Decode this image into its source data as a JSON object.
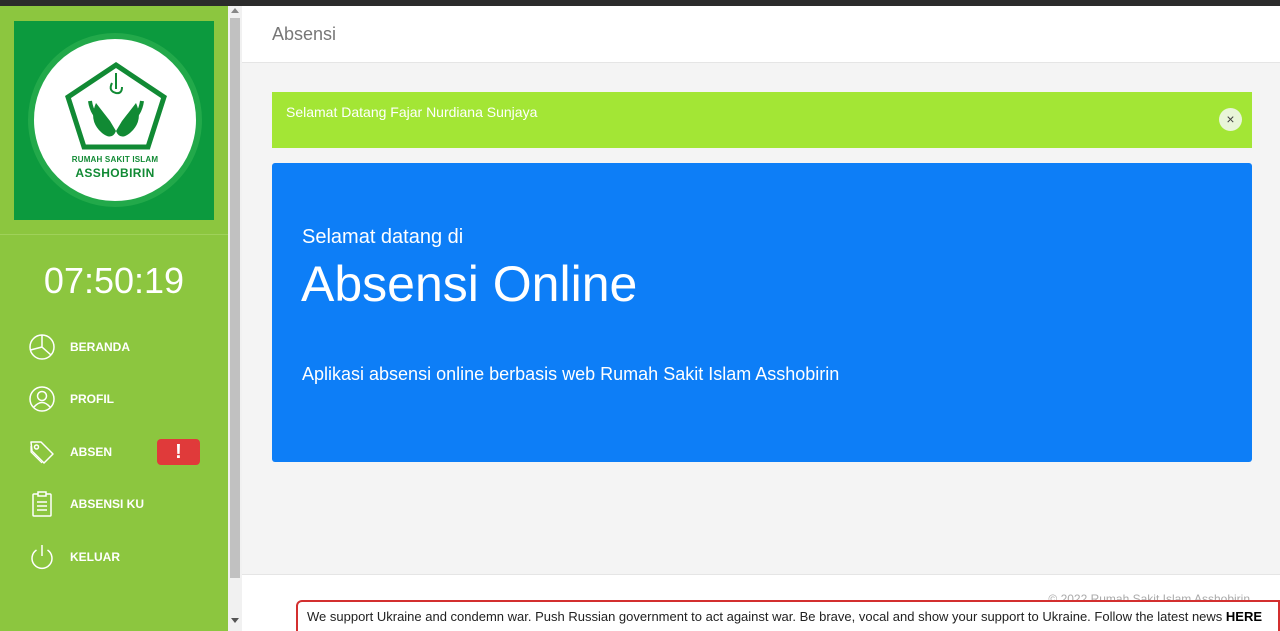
{
  "page": {
    "title": "Absensi"
  },
  "logo": {
    "line1": "RUMAH SAKIT ISLAM",
    "line2": "ASSHOBIRIN"
  },
  "clock": "07:50:19",
  "sidebar": {
    "items": [
      {
        "label": "BERANDA",
        "icon": "pie-chart-icon"
      },
      {
        "label": "PROFIL",
        "icon": "user-circle-icon"
      },
      {
        "label": "ABSEN",
        "icon": "tag-icon",
        "badge": "!"
      },
      {
        "label": "ABSENSI KU",
        "icon": "clipboard-icon"
      },
      {
        "label": "KELUAR",
        "icon": "power-icon"
      }
    ]
  },
  "alert": {
    "message": "Selamat Datang Fajar Nurdiana Sunjaya",
    "close": "×"
  },
  "hero": {
    "subtitle": "Selamat datang di",
    "title": "Absensi Online",
    "description": "Aplikasi absensi online berbasis web Rumah Sakit Islam Asshobirin"
  },
  "footer": {
    "copyright": "© 2022 Rumah Sakit Islam Asshobirin"
  },
  "banner": {
    "text": "We support Ukraine and condemn war. Push Russian government to act against war. Be brave, vocal and show your support to Ukraine. Follow the latest news",
    "link": "HERE"
  },
  "colors": {
    "sidebar": "#8cc63f",
    "logo_bg": "#0c9a3e",
    "alert": "#a3e635",
    "hero": "#0d7ef7",
    "badge": "#e03a3a"
  }
}
